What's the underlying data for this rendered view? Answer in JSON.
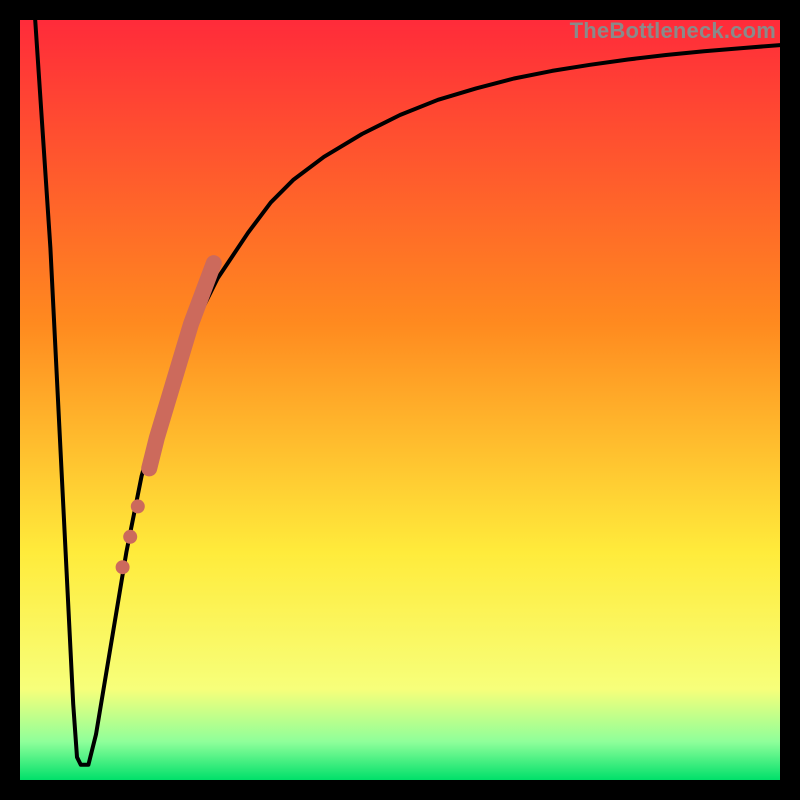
{
  "watermark": "TheBottleneck.com",
  "colors": {
    "gradient_top": "#ff2b3a",
    "gradient_mid1": "#ff8a1f",
    "gradient_mid2": "#ffeb3b",
    "gradient_midlight": "#f7ff7a",
    "gradient_bottom_band": "#8eff9a",
    "gradient_bottom": "#00e06a",
    "curve": "#000000",
    "marker": "#cc6a5c",
    "frame": "#000000"
  },
  "chart_data": {
    "type": "line",
    "title": "",
    "xlabel": "",
    "ylabel": "",
    "xlim": [
      0,
      100
    ],
    "ylim": [
      0,
      100
    ],
    "grid": false,
    "legend": false,
    "series": [
      {
        "name": "bottleneck-curve",
        "x": [
          2,
          4,
          6,
          7,
          7.5,
          8,
          9,
          10,
          12,
          14,
          16,
          18,
          20,
          22,
          24,
          26,
          28,
          30,
          33,
          36,
          40,
          45,
          50,
          55,
          60,
          65,
          70,
          75,
          80,
          85,
          90,
          95,
          100
        ],
        "y": [
          100,
          70,
          30,
          10,
          3,
          2,
          2,
          6,
          18,
          30,
          40,
          47,
          53,
          58,
          62,
          66,
          69,
          72,
          76,
          79,
          82,
          85,
          87.5,
          89.5,
          91,
          92.3,
          93.3,
          94.1,
          94.8,
          95.4,
          95.9,
          96.3,
          96.7
        ]
      }
    ],
    "markers": {
      "name": "highlight-segment",
      "shape": "circle",
      "color": "#cc6a5c",
      "points_xy": [
        [
          17,
          41
        ],
        [
          18,
          45
        ],
        [
          19.5,
          50
        ],
        [
          21,
          55
        ],
        [
          22.5,
          60
        ],
        [
          24,
          64
        ],
        [
          25.5,
          68
        ]
      ],
      "extra_dots_xy": [
        [
          15.5,
          36
        ],
        [
          14.5,
          32
        ],
        [
          13.5,
          28
        ]
      ]
    },
    "optimum_x": 8,
    "annotations": []
  }
}
